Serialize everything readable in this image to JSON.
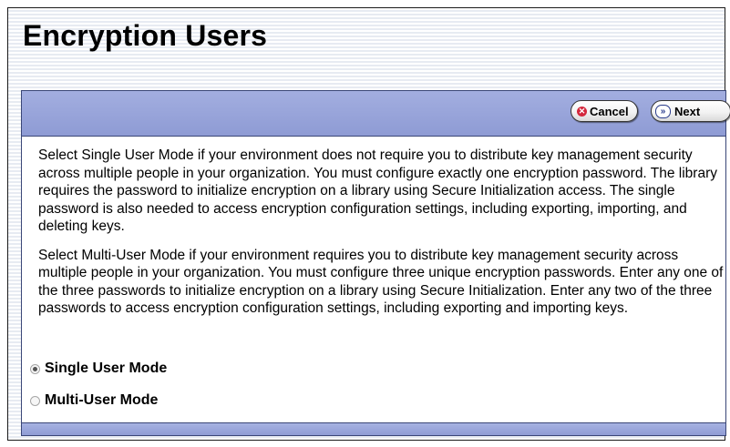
{
  "page_title": "Encryption Users",
  "toolbar": {
    "cancel_label": "Cancel",
    "next_label": "Next"
  },
  "content": {
    "paragraphs": [
      "Select Single User Mode if your environment does not require you to distribute key management security across multiple people in your organization. You must configure exactly one encryption password. The library requires the password to initialize encryption on a library using Secure Initialization access. The single password is also needed to access encryption configuration settings, including exporting, importing, and deleting keys.",
      "Select Multi-User Mode if your environment requires you to distribute key management security across multiple people in your organization. You must configure three unique encryption passwords. Enter any one of the three passwords to initialize encryption on a library using Secure Initialization. Enter any two of the three passwords to access encryption configuration settings, including exporting and importing keys."
    ]
  },
  "mode_options": [
    {
      "label": "Single User Mode",
      "selected": true
    },
    {
      "label": "Multi-User Mode",
      "selected": false
    }
  ],
  "icons": {
    "cancel": "x-circle-icon",
    "next": "double-chevron-right-icon"
  },
  "colors": {
    "toolbar_bg": "#8e9bd4",
    "panel_border": "#3a4677",
    "cancel_icon": "#d4283c"
  }
}
